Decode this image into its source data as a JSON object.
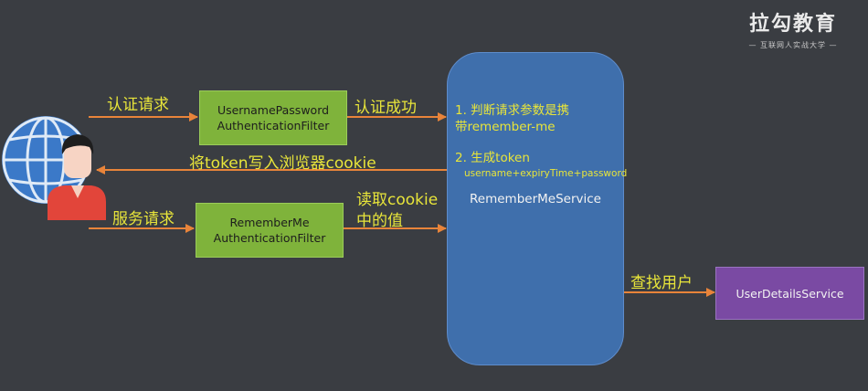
{
  "logo": {
    "title": "拉勾教育",
    "subtitle": "— 互联网人实战大学 —"
  },
  "arrows": {
    "auth_request": "认证请求",
    "auth_success": "认证成功",
    "write_cookie": "将token写入浏览器cookie",
    "service_request": "服务请求",
    "read_cookie_line1": "读取cookie",
    "read_cookie_line2": "中的值",
    "find_user": "查找用户"
  },
  "filters": {
    "username_password_line1": "UsernamePassword",
    "username_password_line2": "AuthenticationFilter",
    "remember_me_line1": "RememberMe",
    "remember_me_line2": "AuthenticationFilter"
  },
  "remember_me_service": {
    "step1_line1": "1. 判断请求参数是携",
    "step1_line2": "带remember-me",
    "step2_title": "2. 生成token",
    "step2_detail": "username+expiryTime+password",
    "name": "RememberMeService"
  },
  "user_details_service": {
    "name": "UserDetailsService"
  },
  "colors": {
    "background": "#3a3d42",
    "label": "#e8e53a",
    "arrow": "#e8843a",
    "filter_box": "#7fb33b",
    "service_box": "#3f6fac",
    "user_details_box": "#7a4aa3"
  },
  "icons": {
    "user": "user-globe-icon"
  }
}
